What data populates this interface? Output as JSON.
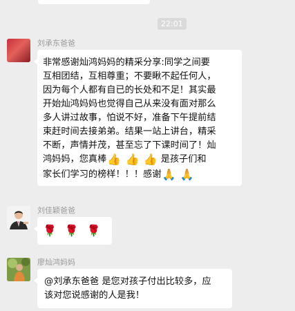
{
  "timestamp": "22:01",
  "messages": [
    {
      "sender": "刘承东爸爸",
      "lines": [
        "非常感谢灿鸿妈妈的精采分享:同学之间要",
        "互相团结，互相尊重；不要瞅不起任何人，",
        "因为每个人都有自已的长处和不足！其实最",
        "开始灿鸿妈妈也觉得自己从来没有面对那么",
        "多人讲过故事，怕说不好，准备下午提前结",
        "束赶时间去接弟弟。结果一站上讲台，精采",
        "不断，声情并茂，甚至忘了下课时间了！灿"
      ],
      "line8_text": "鸿妈妈，您真棒",
      "line8_suffix": "是孩子们和",
      "line9_text": "家长们学习的榜样！！！感谢",
      "emoji": {
        "thumbs_up": "👍",
        "pray": "🙏"
      }
    },
    {
      "sender": "刘佳颖爸爸",
      "rose": "🌹"
    },
    {
      "sender": "廖灿鸿妈妈",
      "lines": [
        "@刘承东爸爸 是您对孩子付出比较多，应",
        "该对您说感谢的人是我！"
      ]
    }
  ],
  "colors": {
    "background": "#ededed",
    "bubble": "#ffffff",
    "sender": "#9a9a9a",
    "timestamp_bg": "#dadada"
  }
}
